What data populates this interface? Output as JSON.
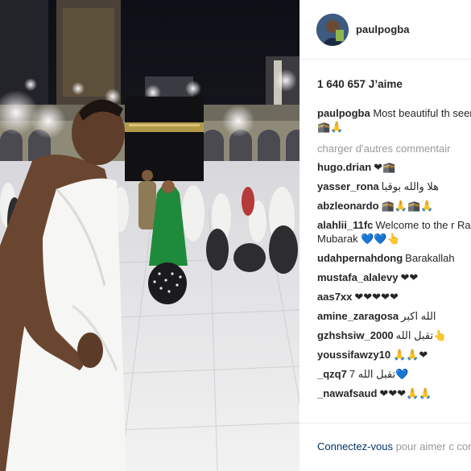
{
  "post": {
    "username": "paulpogba",
    "likes": "1 640 657 J’aime",
    "caption": {
      "username": "paulpogba",
      "text": "Most beautiful th seen in my life 🕋🙏"
    },
    "load_more": "charger d’autres commentair",
    "comments": [
      {
        "user": "hugo.drian",
        "text": "❤🕋"
      },
      {
        "user": "yasser_rona",
        "text": "هلا والله بوقبا"
      },
      {
        "user": "abzleonardo",
        "text": "🕋🙏🕋🙏"
      },
      {
        "user": "alahlii_11fc",
        "text": "Welcome to the r Ramadan Mubarak 💙💙👆"
      },
      {
        "user": "udahpernahdong",
        "text": "Barakallah"
      },
      {
        "user": "mustafa_alalevy",
        "text": "❤❤"
      },
      {
        "user": "aas7xx",
        "text": "❤❤❤❤❤"
      },
      {
        "user": "amine_zaragosa",
        "text": "الله اكبر"
      },
      {
        "user": "gzhshsiw_2000",
        "text": "تقبل الله👆"
      },
      {
        "user": "youssifawzy10",
        "text": "🙏🙏❤"
      },
      {
        "user": "_qzq7",
        "text": "تقبل الله 7💙"
      },
      {
        "user": "_nawafsaud",
        "text": "❤❤❤🙏🙏"
      }
    ],
    "footer": {
      "login_link": "Connectez-vous",
      "login_text": " pour aimer c commenter."
    }
  },
  "colors": {
    "text": "#262626",
    "muted": "#999999",
    "link": "#003569",
    "divider": "#efefef"
  }
}
